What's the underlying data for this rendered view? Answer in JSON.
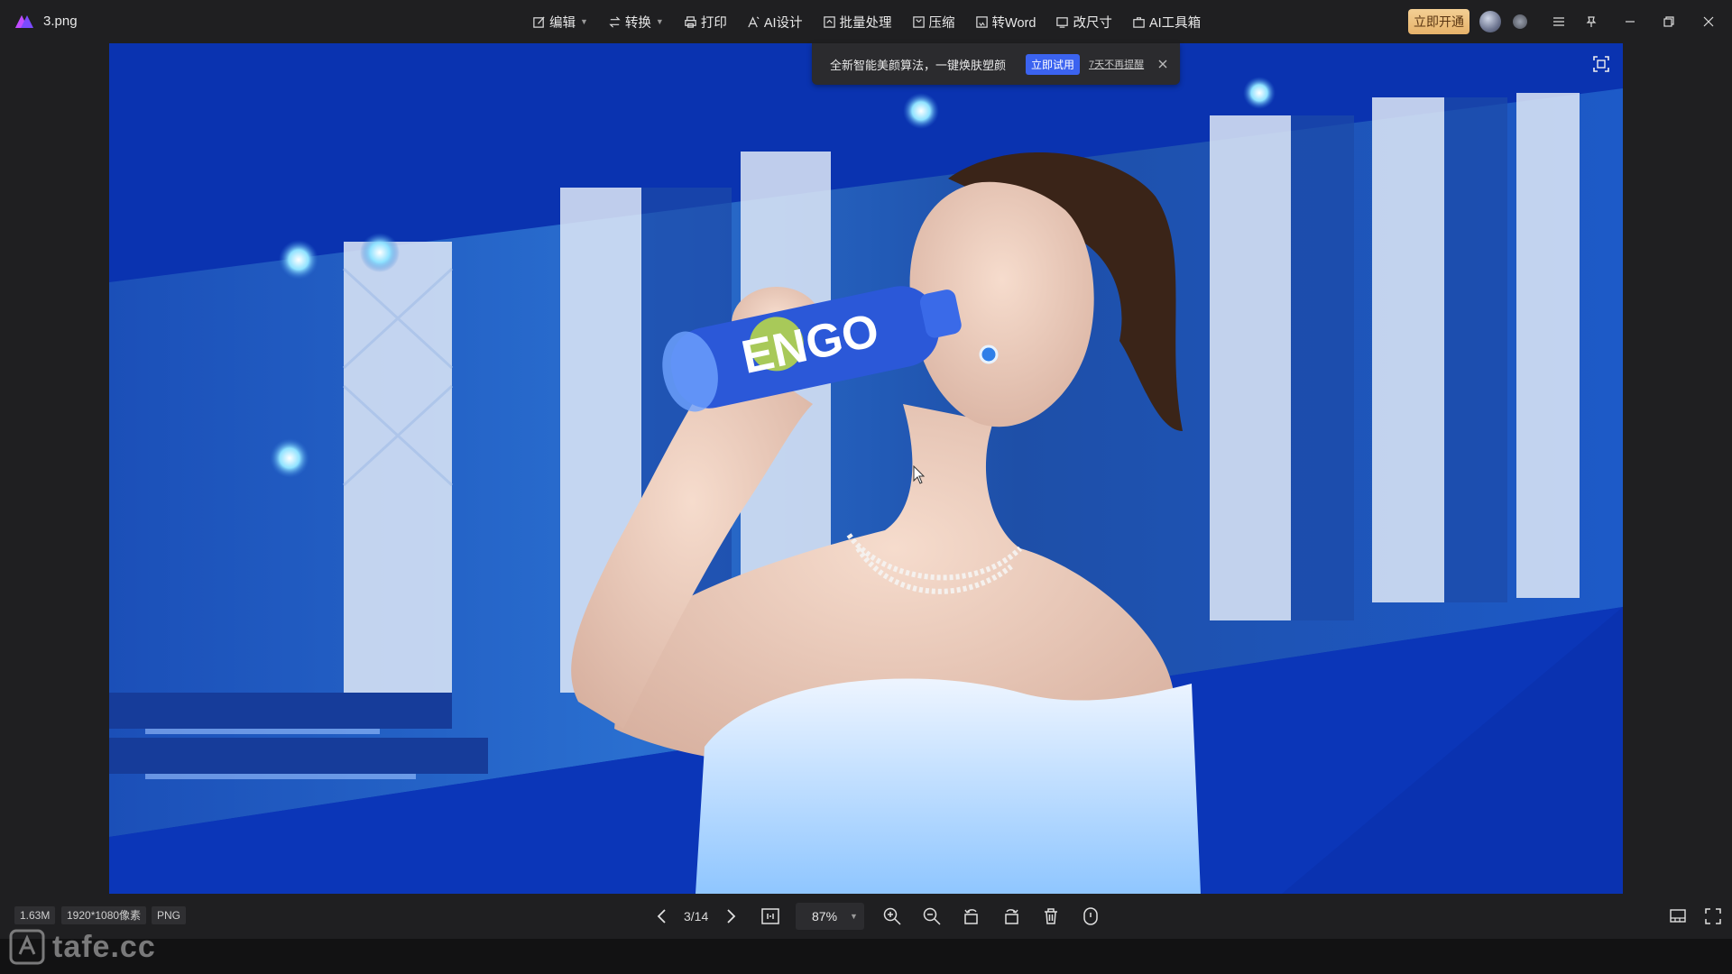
{
  "window": {
    "filename": "3.png"
  },
  "toolbar": {
    "items": [
      {
        "label": "编辑",
        "has_dropdown": true,
        "icon": "edit-icon"
      },
      {
        "label": "转换",
        "has_dropdown": true,
        "icon": "convert-icon"
      },
      {
        "label": "打印",
        "has_dropdown": false,
        "icon": "print-icon"
      },
      {
        "label": "AI设计",
        "has_dropdown": false,
        "icon": "ai-design-icon"
      },
      {
        "label": "批量处理",
        "has_dropdown": false,
        "icon": "batch-icon"
      },
      {
        "label": "压缩",
        "has_dropdown": false,
        "icon": "compress-icon"
      },
      {
        "label": "转Word",
        "has_dropdown": false,
        "icon": "word-icon"
      },
      {
        "label": "改尺寸",
        "has_dropdown": false,
        "icon": "resize-icon"
      },
      {
        "label": "AI工具箱",
        "has_dropdown": false,
        "icon": "ai-toolbox-icon"
      }
    ],
    "vip_label": "立即开通"
  },
  "notification": {
    "text": "全新智能美颜算法，一键焕肤塑颜",
    "try_label": "立即试用",
    "dismiss_label": "7天不再提醒"
  },
  "photo": {
    "bottle_text": "ENGO"
  },
  "bottombar": {
    "file_size": "1.63M",
    "dimensions": "1920*1080像素",
    "format": "PNG",
    "page_counter": "3/14",
    "zoom": "87%"
  },
  "watermark": {
    "text": "tafe.cc"
  },
  "colors": {
    "background": "#1f1f21",
    "vip_gradient": "#e6b26a",
    "accent_blue": "#3b63f0",
    "photo_blue": "#0b36b8"
  }
}
